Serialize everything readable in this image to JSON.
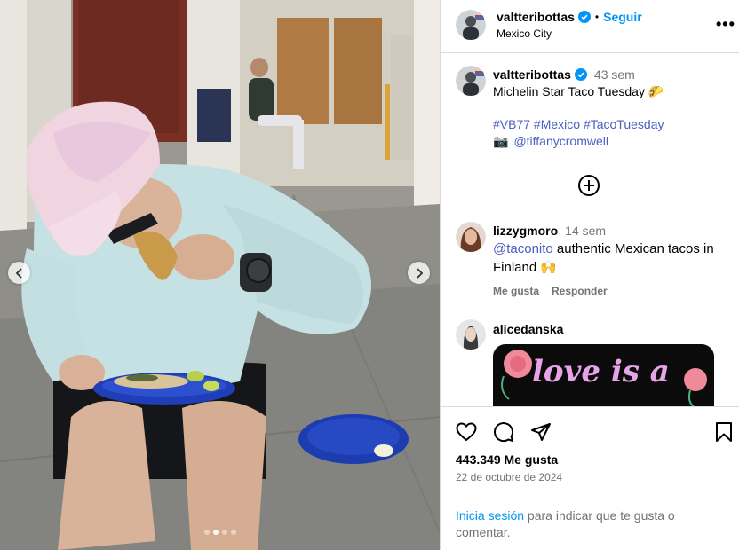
{
  "post": {
    "username": "valtteribottas",
    "follow_label": "Seguir",
    "separator": "•",
    "location": "Mexico City",
    "more_label": "•••"
  },
  "caption": {
    "username": "valtteribottas",
    "time": "43 sem",
    "text": "Michelin Star Taco Tuesday",
    "emoji": "🌮",
    "hashtags": "#VB77 #Mexico #TacoTuesday",
    "camera_emoji": "📷",
    "mention": "@tiffanycromwell"
  },
  "comments": [
    {
      "username": "lizzygmoro",
      "time": "14 sem",
      "mention": "@taconito",
      "text": " authentic Mexican tacos in Finland",
      "emoji": "🙌",
      "like_label": "Me gusta",
      "reply_label": "Responder"
    },
    {
      "username": "alicedanska",
      "image_text": "love is a"
    }
  ],
  "actions": {
    "likes": "443.349 Me gusta",
    "date": "22 de octubre de 2024",
    "login_link": "Inicia sesión",
    "login_rest": " para indicar que te gusta o comentar."
  },
  "carousel": {
    "slides": 4,
    "active": 1
  },
  "colors": {
    "accent": "#0095f6",
    "mention": "#4a5fc1",
    "muted": "#737373",
    "border": "#dbdbdb"
  },
  "icons": [
    "chevron-left-icon",
    "chevron-right-icon",
    "verified-badge-icon",
    "more-icon",
    "plus-circle-icon",
    "heart-icon",
    "comment-icon",
    "share-icon",
    "bookmark-icon"
  ]
}
